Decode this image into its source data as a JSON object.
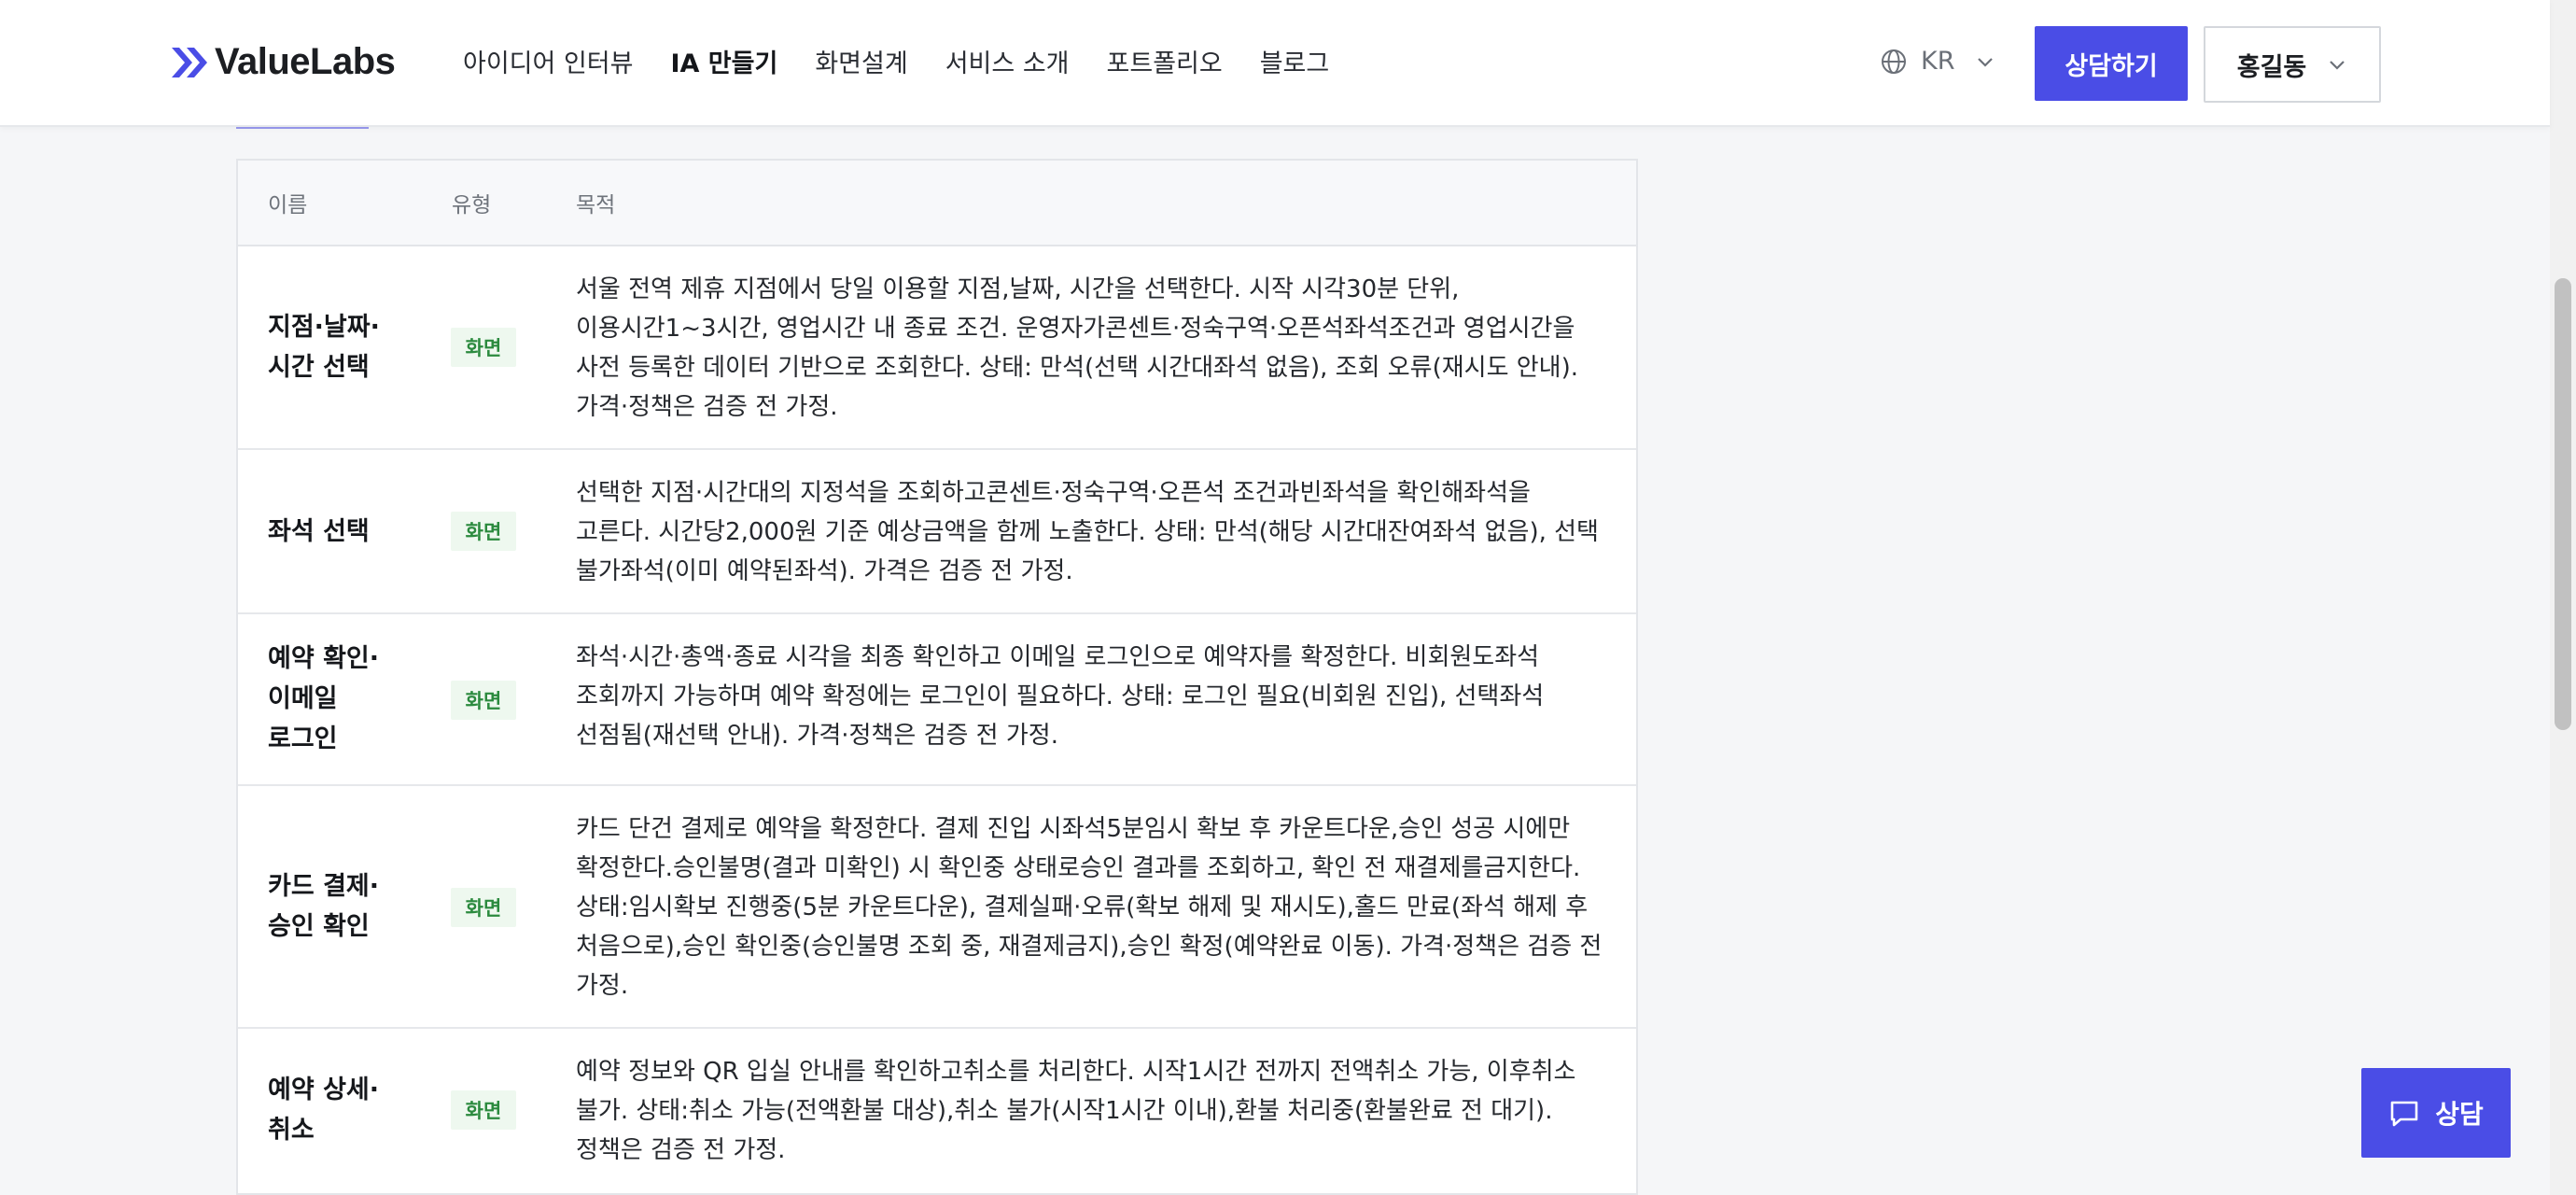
{
  "brand": {
    "name": "ValueLabs",
    "accent": "#4a4de6"
  },
  "nav": {
    "items": [
      {
        "label": "아이디어 인터뷰"
      },
      {
        "label": "IA 만들기"
      },
      {
        "label": "화면설계"
      },
      {
        "label": "서비스 소개"
      },
      {
        "label": "포트폴리오"
      },
      {
        "label": "블로그"
      }
    ],
    "active_index": 1
  },
  "header": {
    "language": "KR",
    "consult_label": "상담하기",
    "user_name": "홍길동"
  },
  "table": {
    "columns": {
      "name": "이름",
      "type": "유형",
      "purpose": "목적"
    },
    "rows": [
      {
        "name": "지점·날짜·\n시간 선택",
        "type": "화면",
        "purpose": "서울 전역 제휴 지점에서 당일 이용할 지점,날짜, 시간을 선택한다. 시작 시각30분 단위,\n이용시간1~3시간, 영업시간 내 종료 조건. 운영자가콘센트·정숙구역·오픈석좌석조건과 영업시간을\n사전 등록한 데이터 기반으로 조회한다. 상태: 만석(선택 시간대좌석 없음), 조회 오류(재시도 안내).\n가격·정책은 검증 전 가정."
      },
      {
        "name": "좌석 선택",
        "type": "화면",
        "purpose": "선택한 지점·시간대의 지정석을 조회하고콘센트·정숙구역·오픈석 조건과빈좌석을 확인해좌석을\n고른다. 시간당2,000원 기준 예상금액을 함께 노출한다. 상태: 만석(해당 시간대잔여좌석 없음), 선택\n불가좌석(이미 예약된좌석). 가격은 검증 전 가정."
      },
      {
        "name": "예약 확인·\n이메일\n로그인",
        "type": "화면",
        "purpose": "좌석·시간·총액·종료 시각을 최종 확인하고 이메일 로그인으로 예약자를 확정한다. 비회원도좌석\n조회까지 가능하며 예약 확정에는 로그인이 필요하다. 상태: 로그인 필요(비회원 진입), 선택좌석\n선점됨(재선택 안내). 가격·정책은 검증 전 가정."
      },
      {
        "name": "카드 결제·\n승인 확인",
        "type": "화면",
        "purpose": "카드 단건 결제로 예약을 확정한다. 결제 진입 시좌석5분임시 확보 후 카운트다운,승인 성공 시에만\n확정한다.승인불명(결과 미확인) 시 확인중 상태로승인 결과를 조회하고, 확인 전 재결제를금지한다.\n상태:임시확보 진행중(5분 카운트다운), 결제실패·오류(확보 해제 및 재시도),홀드 만료(좌석 해제 후\n처음으로),승인 확인중(승인불명 조회 중, 재결제금지),승인 확정(예약완료 이동). 가격·정책은 검증 전\n가정."
      },
      {
        "name": "예약 상세·\n취소",
        "type": "화면",
        "purpose": "예약 정보와 QR 입실 안내를 확인하고취소를 처리한다. 시작1시간 전까지 전액취소 가능, 이후취소\n불가. 상태:취소 가능(전액환불 대상),취소 불가(시작1시간 이내),환불 처리중(환불완료 전 대기).\n정책은 검증 전 가정."
      }
    ]
  },
  "chat": {
    "label": "상담"
  }
}
